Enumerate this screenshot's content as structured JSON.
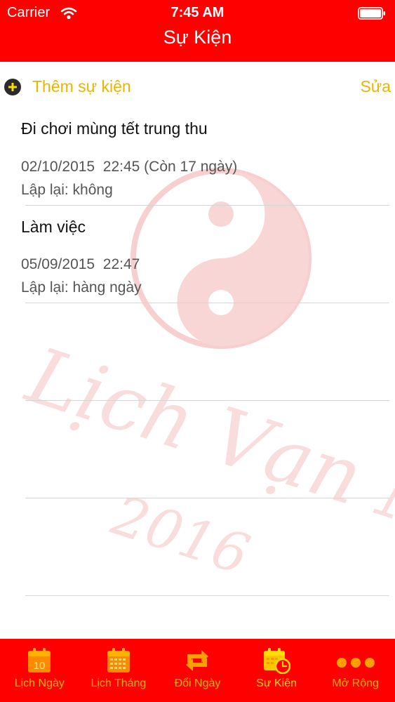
{
  "status_bar": {
    "carrier": "Carrier",
    "time": "7:45 AM"
  },
  "nav": {
    "title": "Sự Kiện"
  },
  "actions": {
    "add_label": "Thêm sự kiện",
    "edit_label": "Sửa"
  },
  "events": [
    {
      "title": "Đi chơi mùng tết trung thu",
      "datetime": "02/10/2015  22:45 (Còn 17 ngày)",
      "repeat": "Lập lại: không"
    },
    {
      "title": "Làm việc",
      "datetime": "05/09/2015  22:47",
      "repeat": "Lập lại: hàng ngày"
    }
  ],
  "tabs": [
    {
      "label": "Lịch Ngày",
      "icon": "calendar-day-icon",
      "icon_text": "10",
      "active": false
    },
    {
      "label": "Lịch Tháng",
      "icon": "calendar-month-icon",
      "active": false
    },
    {
      "label": "Đổi Ngày",
      "icon": "swap-arrows-icon",
      "active": false
    },
    {
      "label": "Sự Kiện",
      "icon": "calendar-clock-icon",
      "active": true
    },
    {
      "label": "Mở Rộng",
      "icon": "more-dots-icon",
      "active": false
    }
  ],
  "watermark": {
    "text": "Lịch Vạn Niên",
    "year": "2016"
  },
  "colors": {
    "bar_red": "#ff0000",
    "accent_gold": "#e8b600",
    "active_tab": "#ffd800",
    "watermark": "#f5c0c0"
  }
}
